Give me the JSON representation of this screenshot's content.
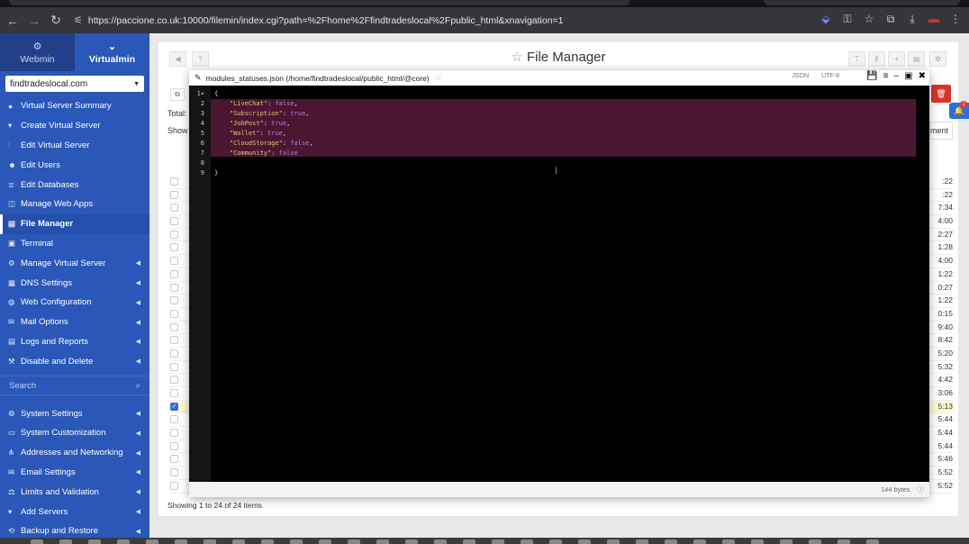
{
  "browser": {
    "url": "https://paccione.co.uk:10000/filemin/index.cgi?path=%2Fhome%2Ffindtradeslocal%2Fpublic_html&xnavigation=1",
    "nav_icons": [
      "back-arrow-icon",
      "forward-arrow-icon",
      "reload-icon"
    ],
    "right_icons": [
      "extension-icon",
      "password-key-icon",
      "bookmark-star-icon",
      "extensions-puzzle-icon",
      "download-icon",
      "profile-avatar-icon",
      "kebab-menu-icon"
    ]
  },
  "sidebar": {
    "tabs": [
      {
        "label": "Webmin",
        "icon": "webmin-gear-icon"
      },
      {
        "label": "Virtualmin",
        "icon": "chevron-down-icon"
      }
    ],
    "domain": "findtradeslocal.com",
    "items": [
      {
        "label": "Virtual Server Summary",
        "icon": "info-icon",
        "chevron": false
      },
      {
        "label": "Create Virtual Server",
        "icon": "plus-icon",
        "chevron": false
      },
      {
        "label": "Edit Virtual Server",
        "icon": "sliders-icon",
        "chevron": false
      },
      {
        "label": "Edit Users",
        "icon": "users-icon",
        "chevron": false
      },
      {
        "label": "Edit Databases",
        "icon": "database-icon",
        "chevron": false
      },
      {
        "label": "Manage Web Apps",
        "icon": "web-apps-icon",
        "chevron": false
      },
      {
        "label": "File Manager",
        "icon": "folder-icon",
        "chevron": false,
        "active": true
      },
      {
        "label": "Terminal",
        "icon": "terminal-icon",
        "chevron": false
      },
      {
        "label": "Manage Virtual Server",
        "icon": "cogs-icon",
        "chevron": true
      },
      {
        "label": "DNS Settings",
        "icon": "dns-server-icon",
        "chevron": true
      },
      {
        "label": "Web Configuration",
        "icon": "globe-icon",
        "chevron": true
      },
      {
        "label": "Mail Options",
        "icon": "envelope-icon",
        "chevron": true
      },
      {
        "label": "Logs and Reports",
        "icon": "document-icon",
        "chevron": true
      },
      {
        "label": "Disable and Delete",
        "icon": "wrench-icon",
        "chevron": true
      }
    ],
    "search_placeholder": "Search",
    "items2": [
      {
        "label": "System Settings",
        "icon": "gear-icon",
        "chevron": true
      },
      {
        "label": "System Customization",
        "icon": "monitor-icon",
        "chevron": true
      },
      {
        "label": "Addresses and Networking",
        "icon": "network-icon",
        "chevron": true
      },
      {
        "label": "Email Settings",
        "icon": "envelope-icon",
        "chevron": true
      },
      {
        "label": "Limits and Validation",
        "icon": "limits-icon",
        "chevron": true
      },
      {
        "label": "Add Servers",
        "icon": "plus-icon",
        "chevron": true
      },
      {
        "label": "Backup and Restore",
        "icon": "backup-icon",
        "chevron": true
      }
    ]
  },
  "file_manager": {
    "title": "File Manager",
    "total_label": "Total:",
    "show_label": "Show",
    "entries_label": "ment",
    "footer": "Showing 1 to 24 of 24 items",
    "row_times": [
      ":22",
      ":22",
      "7:34",
      "4:00",
      "2:27",
      "1:28",
      "4:00",
      "1:22",
      "0:27",
      "1:22",
      "0:15",
      "9:40",
      "8:42",
      "5:20",
      "5:32",
      "4:42",
      "3:06",
      "5:13",
      "5:44",
      "5:44",
      "5:44",
      "5:46",
      "5:52",
      "5:52"
    ],
    "checked_row": 17
  },
  "editor": {
    "filename": "modules_statuses.json (/home/findtradeslocal/public_html/@core)",
    "mode": "JSON",
    "encoding": "UTF-8",
    "size": "144 bytes",
    "lines": [
      [
        {
          "t": "{",
          "c": "punc"
        }
      ],
      [
        {
          "t": "    "
        },
        {
          "t": "\"LiveChat\"",
          "c": "key"
        },
        {
          "t": ": ",
          "c": "punc"
        },
        {
          "t": "false",
          "c": "bool"
        },
        {
          "t": ",",
          "c": "punc"
        }
      ],
      [
        {
          "t": "    "
        },
        {
          "t": "\"Subscription\"",
          "c": "key"
        },
        {
          "t": ": ",
          "c": "punc"
        },
        {
          "t": "true",
          "c": "bool"
        },
        {
          "t": ",",
          "c": "punc"
        }
      ],
      [
        {
          "t": "    "
        },
        {
          "t": "\"JobPost\"",
          "c": "key"
        },
        {
          "t": ": ",
          "c": "punc"
        },
        {
          "t": "true",
          "c": "bool"
        },
        {
          "t": ",",
          "c": "punc"
        }
      ],
      [
        {
          "t": "    "
        },
        {
          "t": "\"Wallet\"",
          "c": "key"
        },
        {
          "t": ": ",
          "c": "punc"
        },
        {
          "t": "true",
          "c": "bool"
        },
        {
          "t": ",",
          "c": "punc"
        }
      ],
      [
        {
          "t": "    "
        },
        {
          "t": "\"CloudStorage\"",
          "c": "key"
        },
        {
          "t": ": ",
          "c": "punc"
        },
        {
          "t": "false",
          "c": "bool"
        },
        {
          "t": ",",
          "c": "punc"
        }
      ],
      [
        {
          "t": "    "
        },
        {
          "t": "\"Community\"",
          "c": "key"
        },
        {
          "t": ": ",
          "c": "punc"
        },
        {
          "t": "false",
          "c": "bool"
        }
      ],
      [
        {
          "t": ""
        }
      ],
      [
        {
          "t": "}",
          "c": "punc"
        }
      ]
    ]
  },
  "notifications": {
    "count": "1"
  }
}
